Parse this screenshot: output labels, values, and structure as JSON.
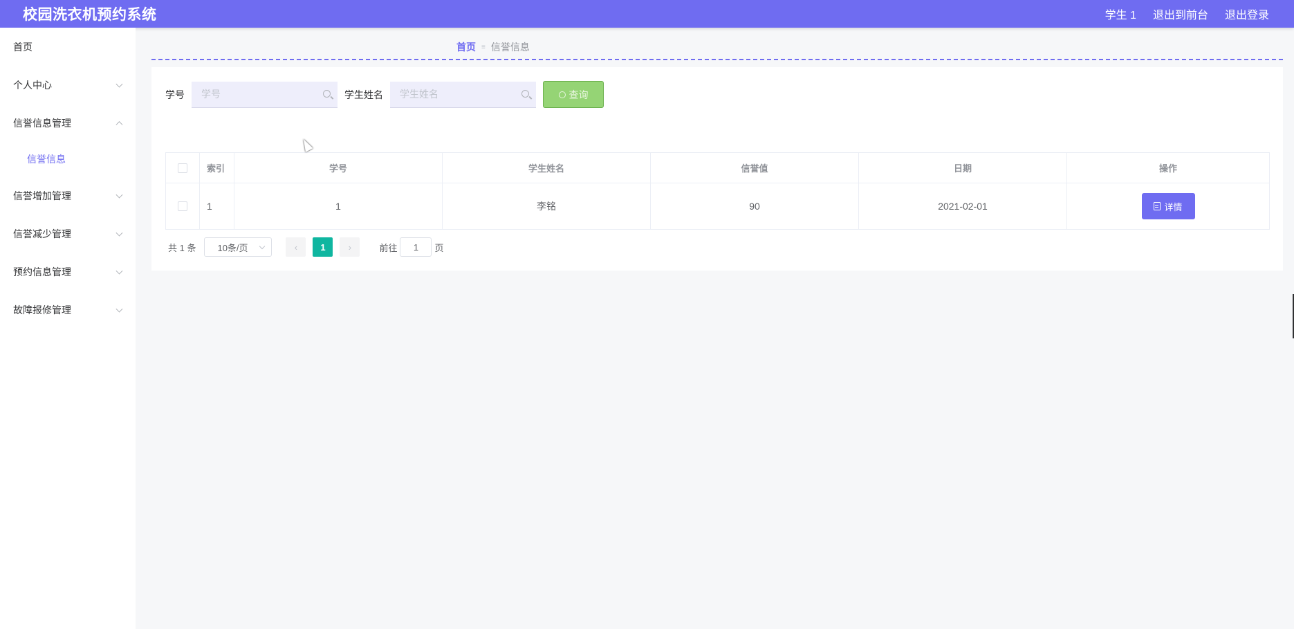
{
  "header": {
    "app_title": "校园洗衣机预约系统",
    "user_label": "学生 1",
    "front_label": "退出到前台",
    "logout_label": "退出登录"
  },
  "sidebar": {
    "items": [
      {
        "label": "首页"
      },
      {
        "label": "个人中心"
      },
      {
        "label": "信誉信息管理"
      },
      {
        "label": "信誉信息"
      },
      {
        "label": "信誉增加管理"
      },
      {
        "label": "信誉减少管理"
      },
      {
        "label": "预约信息管理"
      },
      {
        "label": "故障报修管理"
      }
    ]
  },
  "breadcrumb": {
    "home": "首页",
    "separator": "≡",
    "current": "信誉信息"
  },
  "search": {
    "sid_label": "学号",
    "sid_placeholder": "学号",
    "name_label": "学生姓名",
    "name_placeholder": "学生姓名",
    "query_label": "查询"
  },
  "table": {
    "headers": [
      "索引",
      "学号",
      "学生姓名",
      "信誉值",
      "日期",
      "操作"
    ],
    "rows": [
      {
        "index": "1",
        "student_id": "1",
        "student_name": "李铭",
        "credit": "90",
        "date": "2021-02-01",
        "action": "详情"
      }
    ]
  },
  "pagination": {
    "total": "共 1 条",
    "page_size": "10条/页",
    "prev": "‹",
    "current_page": "1",
    "next": "›",
    "goto_label": "前往",
    "goto_value": "1",
    "page_suffix": "页"
  },
  "colors": {
    "accent": "#6f6cf1",
    "query_button": "#95d475",
    "active_page": "#0fb6a0"
  }
}
